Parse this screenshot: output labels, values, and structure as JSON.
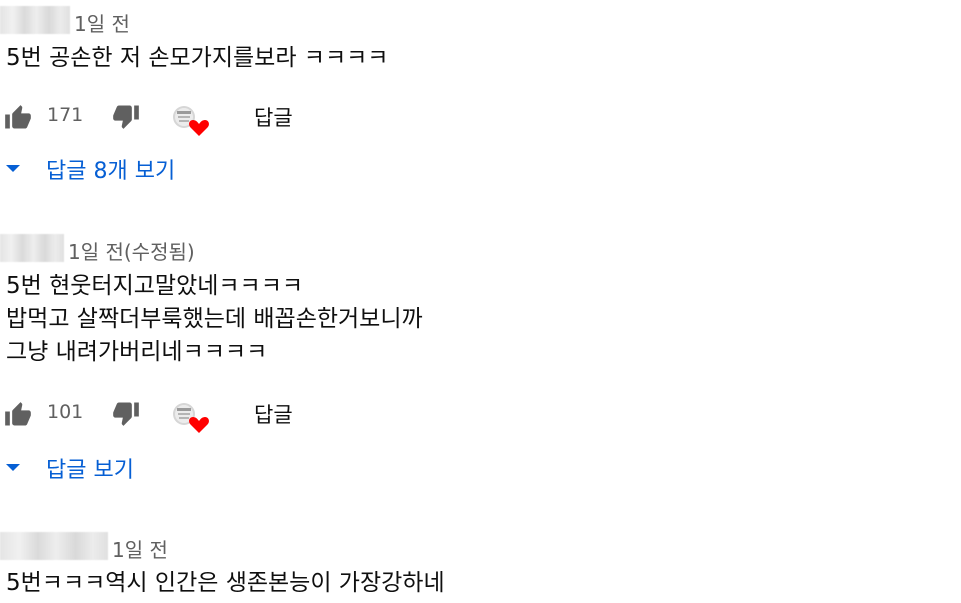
{
  "comments": [
    {
      "time": "1일 전",
      "lines": [
        "5번 공손한 저 손모가지를보라 ㅋㅋㅋㅋ"
      ],
      "like_count": "171",
      "reply_label": "답글",
      "replies_label": "답글 8개 보기"
    },
    {
      "time": "1일 전(수정됨)",
      "lines": [
        "5번 현웃터지고말았네ㅋㅋㅋㅋ",
        "밥먹고 살짝더부룩했는데 배꼽손한거보니까",
        "그냥 내려가버리네ㅋㅋㅋㅋ"
      ],
      "like_count": "101",
      "reply_label": "답글",
      "replies_label": "답글 보기"
    },
    {
      "time": "1일 전",
      "lines": [
        "5번ㅋㅋㅋ역시 인간은 생존본능이 가장강하네"
      ]
    }
  ],
  "colors": {
    "link_blue": "#065fd4",
    "meta_gray": "#606060",
    "icon_gray": "#606060",
    "heart_red": "#ff0000"
  },
  "icons": {
    "like": "thumbs-up-icon",
    "dislike": "thumbs-down-icon",
    "creator_heart": "creator-heart-icon",
    "expand": "caret-down-icon"
  }
}
